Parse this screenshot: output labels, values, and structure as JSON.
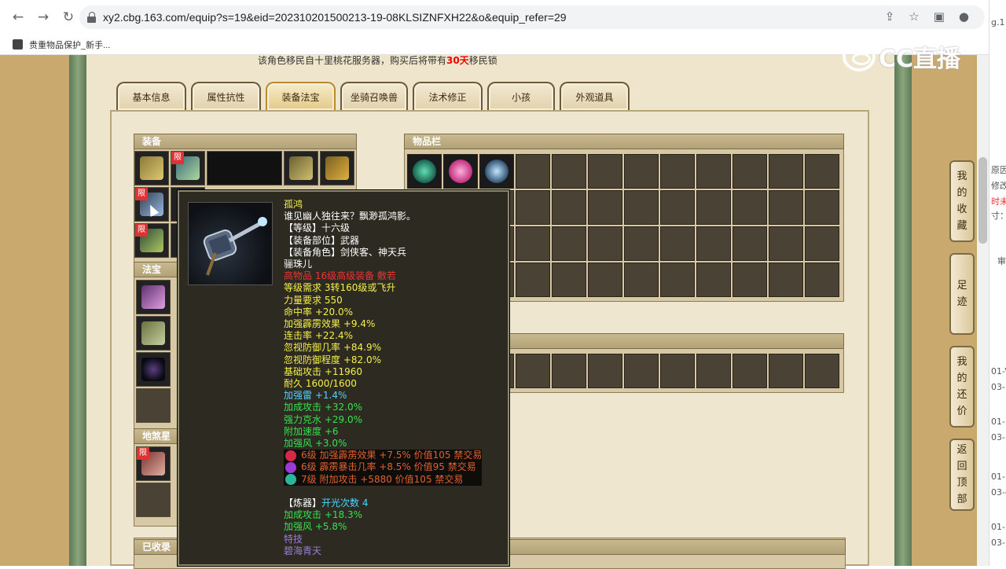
{
  "browser": {
    "url": "xy2.cbg.163.com/equip?s=19&eid=202310201500213-19-08KLSIZNFXH22&o&equip_refer=29",
    "bookmark": "贵重物品保护_新手..."
  },
  "watermark": "CC直播",
  "notice": {
    "prefix": "该角色移民自十里桃花服务器，购买后将带有",
    "days": "30天",
    "suffix": "移民锁"
  },
  "tabs": [
    {
      "label": "基本信息"
    },
    {
      "label": "属性抗性"
    },
    {
      "label": "装备法宝",
      "active": true
    },
    {
      "label": "坐骑召唤兽"
    },
    {
      "label": "法术修正"
    },
    {
      "label": "小孩"
    },
    {
      "label": "外观道具"
    }
  ],
  "panels": {
    "equip": "装备",
    "fabao": "法宝",
    "disha": "地煞星",
    "inventory": "物品栏",
    "collected": "已收录"
  },
  "limit_badge": "限",
  "right_float": [
    {
      "label": "我的收藏",
      "chars": [
        "我",
        "的",
        "收",
        "藏"
      ]
    },
    {
      "label": "足迹",
      "chars": [
        "足",
        "迹"
      ]
    },
    {
      "label": "我的还价",
      "chars": [
        "我",
        "的",
        "还",
        "价"
      ]
    },
    {
      "label": "返回顶部",
      "chars": [
        "返",
        "回",
        "顶",
        "部"
      ]
    }
  ],
  "tooltip": {
    "name": "孤鸿",
    "flavor": "谁见幽人独往来？飘渺孤鸿影。",
    "level": "【等级】十六级",
    "slot": "【装备部位】武器",
    "role": "【装备角色】剑侠客、神天兵",
    "crafter": "骊珠儿",
    "note": "高物品 16级高级装备 敷若",
    "req_level": "等级需求 3转160级或飞升",
    "req_str": "力量要求 550",
    "stats_yellow": [
      "命中率 +20.0%",
      "加强霹雳效果 +9.4%",
      "连击率 +22.4%",
      "忽视防御几率 +84.9%",
      "忽视防御程度 +82.0%",
      "基础攻击 +11960",
      "耐久 1600/1600"
    ],
    "stats_cyan": [
      "加强雷 +1.4%"
    ],
    "stats_green": [
      "加成攻击 +32.0%",
      "强力克水 +29.0%",
      "附加速度 +6",
      "加强风 +3.0%"
    ],
    "gems": [
      {
        "text": "6级 加强霹雳效果 +7.5% 价值105 禁交易",
        "color": "#d8284a"
      },
      {
        "text": "6级 霹雳暴击几率 +8.5% 价值95 禁交易",
        "color": "#9b3ad4"
      },
      {
        "text": "7级 附加攻击 +5880 价值105 禁交易",
        "color": "#27b89a"
      }
    ],
    "refine_label": "【炼器】",
    "refine_count": "开光次数 4",
    "refine_stats": [
      "加成攻击 +18.3%",
      "加强风 +5.8%"
    ],
    "skill_label": "特技",
    "skill_name": "碧海青天"
  },
  "side_page_fragments": [
    "g.1",
    "原因",
    "修改",
    "时未",
    "寸：",
    "审",
    "01-V",
    "03-F",
    "01-L",
    "03-IN",
    "01-L",
    "03-c",
    "01-L",
    "03-Q"
  ],
  "colors": {
    "page_bg": "#d9c9a3",
    "panel_bg": "#d7c9a5",
    "slot_bg": "#4a4234",
    "tooltip_bg": "#2d2a22"
  }
}
